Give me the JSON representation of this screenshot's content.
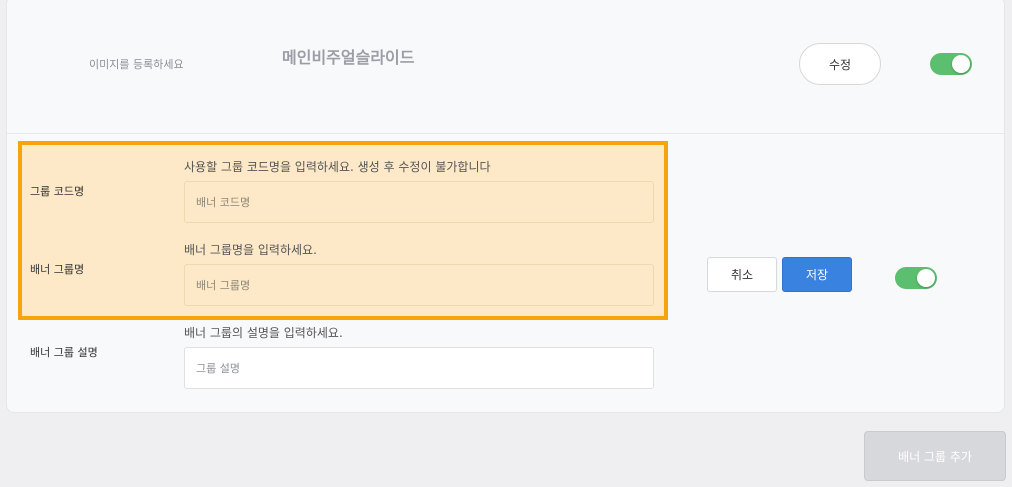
{
  "existing_group": {
    "image_hint": "이미지를 등록하세요",
    "title": "메인비주얼슬라이드",
    "edit_label": "수정",
    "toggle_on": true
  },
  "new_group_form": {
    "code": {
      "label": "그룹 코드명",
      "help": "사용할 그룹 코드명을 입력하세요. 생성 후 수정이 불가합니다",
      "placeholder": "배너 코드명",
      "value": ""
    },
    "name": {
      "label": "배너 그룹명",
      "help": "배너 그룹명을 입력하세요.",
      "placeholder": "배너 그룹명",
      "value": ""
    },
    "description": {
      "label": "배너 그룹 설명",
      "help": "배너 그룹의 설명을 입력하세요.",
      "placeholder": "그룹 설명",
      "value": ""
    },
    "cancel_label": "취소",
    "save_label": "저장",
    "toggle_on": true
  },
  "footer": {
    "add_group_label": "배너 그룹 추가"
  },
  "colors": {
    "highlight_border": "#f7a30c",
    "highlight_fill": "#fde9c8",
    "save_button": "#3a82e0",
    "toggle_on": "#5bbf6f",
    "add_button_disabled": "#d7d8db"
  }
}
